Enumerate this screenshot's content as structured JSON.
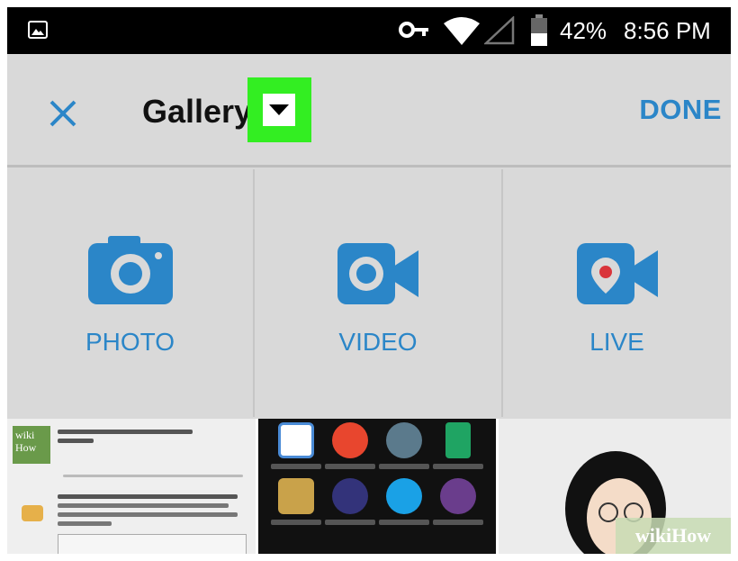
{
  "status_bar": {
    "battery": "42%",
    "time": "8:56 PM",
    "icons": [
      "image-icon",
      "vpn-key-icon",
      "wifi-icon",
      "signal-icon",
      "battery-icon"
    ]
  },
  "app_bar": {
    "close_icon": "close-icon",
    "title": "Gallery",
    "dropdown_icon": "caret-down-icon",
    "done_label": "DONE"
  },
  "capture_options": [
    {
      "label": "PHOTO",
      "icon": "camera-icon"
    },
    {
      "label": "VIDEO",
      "icon": "video-camera-icon"
    },
    {
      "label": "LIVE",
      "icon": "live-broadcast-icon"
    }
  ],
  "colors": {
    "accent": "#2b86c8",
    "highlight": "#33ee22",
    "background": "#d9d9d9"
  },
  "watermark": "wikiHow"
}
